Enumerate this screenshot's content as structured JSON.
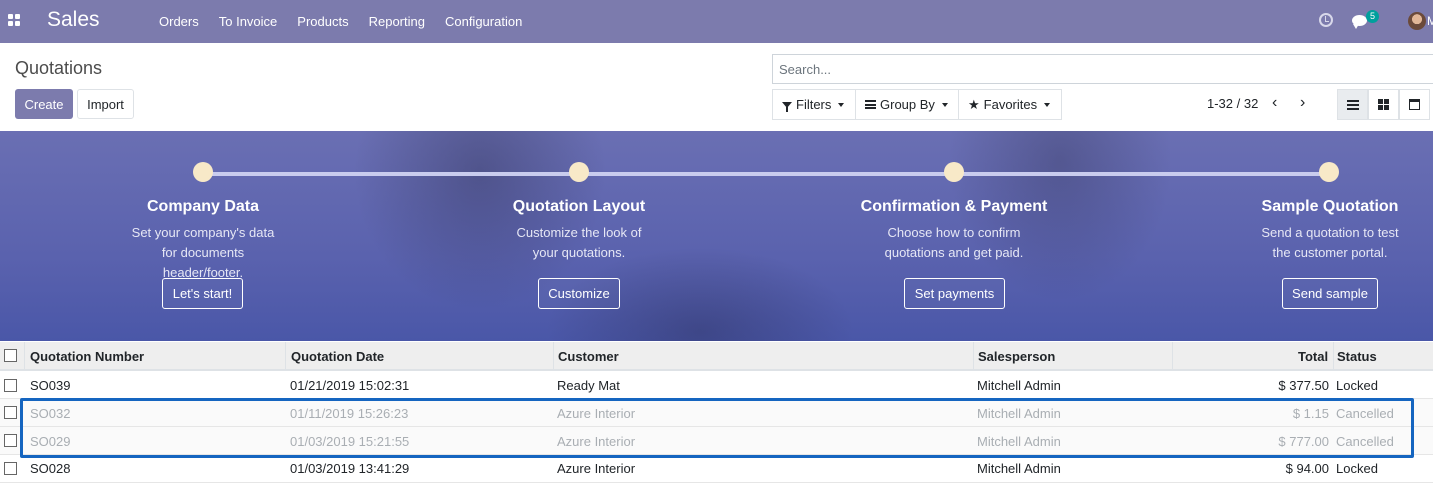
{
  "navbar": {
    "app_name": "Sales",
    "menu": [
      "Orders",
      "To Invoice",
      "Products",
      "Reporting",
      "Configuration"
    ],
    "chat_count": "5",
    "user_initial": "M"
  },
  "control_panel": {
    "title": "Quotations",
    "create_label": "Create",
    "import_label": "Import",
    "search_placeholder": "Search...",
    "filters_label": "Filters",
    "group_by_label": "Group By",
    "favorites_label": "Favorites",
    "pager": "1-32 / 32"
  },
  "onboarding": {
    "steps": [
      {
        "title": "Company Data",
        "desc": "Set your company's data for documents header/footer.",
        "button": "Let's start!"
      },
      {
        "title": "Quotation Layout",
        "desc": "Customize the look of your quotations.",
        "button": "Customize"
      },
      {
        "title": "Confirmation & Payment",
        "desc": "Choose how to confirm quotations and get paid.",
        "button": "Set payments"
      },
      {
        "title": "Sample Quotation",
        "desc": "Send a quotation to test the customer portal.",
        "button": "Send sample"
      }
    ]
  },
  "table": {
    "headers": {
      "number": "Quotation Number",
      "date": "Quotation Date",
      "customer": "Customer",
      "salesperson": "Salesperson",
      "total": "Total",
      "status": "Status"
    },
    "rows": [
      {
        "number": "SO039",
        "date": "01/21/2019 15:02:31",
        "customer": "Ready Mat",
        "salesperson": "Mitchell Admin",
        "total": "$ 377.50",
        "status": "Locked"
      },
      {
        "number": "SO032",
        "date": "01/11/2019 15:26:23",
        "customer": "Azure Interior",
        "salesperson": "Mitchell Admin",
        "total": "$ 1.15",
        "status": "Cancelled"
      },
      {
        "number": "SO029",
        "date": "01/03/2019 15:21:55",
        "customer": "Azure Interior",
        "salesperson": "Mitchell Admin",
        "total": "$ 777.00",
        "status": "Cancelled"
      },
      {
        "number": "SO028",
        "date": "01/03/2019 13:41:29",
        "customer": "Azure Interior",
        "salesperson": "Mitchell Admin",
        "total": "$ 94.00",
        "status": "Locked"
      }
    ]
  },
  "colors": {
    "brand": "#7c7bad",
    "highlight": "#1565c0",
    "cancelled_text": "#a9aeb3"
  },
  "icons": [
    "apps-icon",
    "clock-icon",
    "chat-icon",
    "funnel-icon",
    "bars-icon",
    "star-icon",
    "chevron-left-icon",
    "chevron-right-icon",
    "list-view-icon",
    "kanban-view-icon",
    "calendar-view-icon"
  ]
}
